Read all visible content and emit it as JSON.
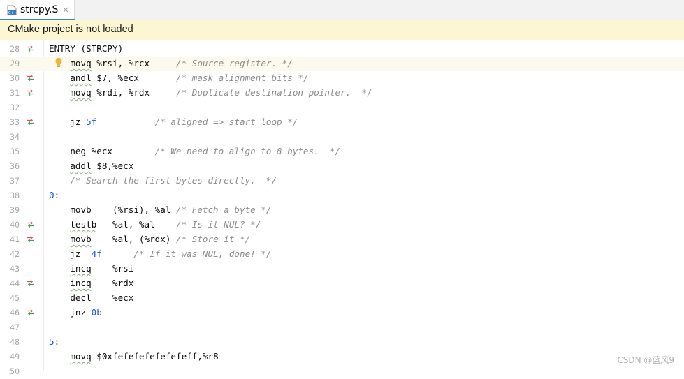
{
  "tab": {
    "title": "strcpy.S",
    "close_glyph": "×",
    "icon": "c-plus-plus-file-icon"
  },
  "banner": {
    "text": "CMake project is not loaded"
  },
  "watermark": "CSDN @蓝风9",
  "lines": [
    {
      "n": "28",
      "marker": true,
      "tokens": [
        {
          "t": "ENTRY (STRCPY)"
        }
      ]
    },
    {
      "n": "29",
      "current": true,
      "bulb": true,
      "tokens": [
        {
          "t": "    "
        },
        {
          "t": "movq",
          "c": "kw"
        },
        {
          "t": " %rsi, %rcx     "
        },
        {
          "t": "/* Source register. */",
          "c": "cmt"
        }
      ]
    },
    {
      "n": "30",
      "marker": true,
      "tokens": [
        {
          "t": "    "
        },
        {
          "t": "andl",
          "c": "kw"
        },
        {
          "t": " $7, %ecx       "
        },
        {
          "t": "/* mask alignment bits */",
          "c": "cmt"
        }
      ]
    },
    {
      "n": "31",
      "marker": true,
      "tokens": [
        {
          "t": "    "
        },
        {
          "t": "movq",
          "c": "kw"
        },
        {
          "t": " %rdi, %rdx     "
        },
        {
          "t": "/* Duplicate destination pointer.  */",
          "c": "cmt"
        }
      ]
    },
    {
      "n": "32",
      "tokens": []
    },
    {
      "n": "33",
      "marker": true,
      "tokens": [
        {
          "t": "    jz "
        },
        {
          "t": "5f",
          "c": "num"
        },
        {
          "t": "           "
        },
        {
          "t": "/* aligned => start loop */",
          "c": "cmt"
        }
      ]
    },
    {
      "n": "34",
      "tokens": []
    },
    {
      "n": "35",
      "tokens": [
        {
          "t": "    neg %ecx        "
        },
        {
          "t": "/* We need to align to 8 bytes.  */",
          "c": "cmt"
        }
      ]
    },
    {
      "n": "36",
      "tokens": [
        {
          "t": "    "
        },
        {
          "t": "addl",
          "c": "kw"
        },
        {
          "t": " $8,%ecx"
        }
      ]
    },
    {
      "n": "37",
      "tokens": [
        {
          "t": "    "
        },
        {
          "t": "/* Search the first bytes directly.  */",
          "c": "cmt"
        }
      ]
    },
    {
      "n": "38",
      "tokens": [
        {
          "t": "0",
          "c": "label"
        },
        {
          "t": ":"
        }
      ]
    },
    {
      "n": "39",
      "tokens": [
        {
          "t": "    movb    (%rsi), %al "
        },
        {
          "t": "/* Fetch a byte */",
          "c": "cmt"
        }
      ]
    },
    {
      "n": "40",
      "marker": true,
      "tokens": [
        {
          "t": "    "
        },
        {
          "t": "testb",
          "c": "kw"
        },
        {
          "t": "   %al, %al    "
        },
        {
          "t": "/* Is it NUL? */",
          "c": "cmt"
        }
      ]
    },
    {
      "n": "41",
      "marker": true,
      "tokens": [
        {
          "t": "    "
        },
        {
          "t": "movb",
          "c": "kw"
        },
        {
          "t": "    %al, (%rdx) "
        },
        {
          "t": "/* Store it */",
          "c": "cmt"
        }
      ]
    },
    {
      "n": "42",
      "tokens": [
        {
          "t": "    jz  "
        },
        {
          "t": "4f",
          "c": "num"
        },
        {
          "t": "      "
        },
        {
          "t": "/* If it was NUL, done! */",
          "c": "cmt"
        }
      ]
    },
    {
      "n": "43",
      "tokens": [
        {
          "t": "    "
        },
        {
          "t": "incq",
          "c": "kw"
        },
        {
          "t": "    %rsi"
        }
      ]
    },
    {
      "n": "44",
      "marker": true,
      "tokens": [
        {
          "t": "    "
        },
        {
          "t": "incq",
          "c": "kw"
        },
        {
          "t": "    %rdx"
        }
      ]
    },
    {
      "n": "45",
      "tokens": [
        {
          "t": "    decl    %ecx"
        }
      ]
    },
    {
      "n": "46",
      "marker": true,
      "tokens": [
        {
          "t": "    jnz "
        },
        {
          "t": "0b",
          "c": "num"
        }
      ]
    },
    {
      "n": "47",
      "tokens": []
    },
    {
      "n": "48",
      "tokens": [
        {
          "t": "5",
          "c": "label"
        },
        {
          "t": ":"
        }
      ]
    },
    {
      "n": "49",
      "tokens": [
        {
          "t": "    "
        },
        {
          "t": "movq",
          "c": "kw"
        },
        {
          "t": " $0xfefefefefefefeff,%r8"
        }
      ]
    },
    {
      "n": "50",
      "tokens": []
    }
  ]
}
